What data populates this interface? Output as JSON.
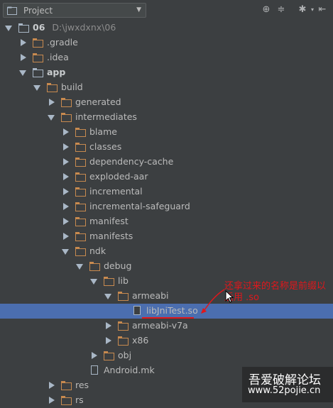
{
  "toolbar": {
    "project_label": "Project",
    "icons": [
      "target-icon",
      "collapse-all-icon",
      "gear-icon",
      "hide-icon"
    ]
  },
  "tree": [
    {
      "label": "06",
      "path": "D:\\jwxdxnx\\06",
      "state": "open",
      "kind": "module",
      "bold": true
    },
    {
      "label": ".gradle",
      "state": "closed",
      "kind": "folder"
    },
    {
      "label": ".idea",
      "state": "closed",
      "kind": "folder"
    },
    {
      "label": "app",
      "state": "open",
      "kind": "module",
      "bold": true
    },
    {
      "label": "build",
      "state": "open",
      "kind": "folder"
    },
    {
      "label": "generated",
      "state": "closed",
      "kind": "folder"
    },
    {
      "label": "intermediates",
      "state": "open",
      "kind": "folder"
    },
    {
      "label": "blame",
      "state": "closed",
      "kind": "folder"
    },
    {
      "label": "classes",
      "state": "closed",
      "kind": "folder"
    },
    {
      "label": "dependency-cache",
      "state": "closed",
      "kind": "folder"
    },
    {
      "label": "exploded-aar",
      "state": "closed",
      "kind": "folder"
    },
    {
      "label": "incremental",
      "state": "closed",
      "kind": "folder"
    },
    {
      "label": "incremental-safeguard",
      "state": "closed",
      "kind": "folder"
    },
    {
      "label": "manifest",
      "state": "closed",
      "kind": "folder"
    },
    {
      "label": "manifests",
      "state": "closed",
      "kind": "folder"
    },
    {
      "label": "ndk",
      "state": "open",
      "kind": "folder"
    },
    {
      "label": "debug",
      "state": "open",
      "kind": "folder"
    },
    {
      "label": "lib",
      "state": "open",
      "kind": "folder"
    },
    {
      "label": "armeabi",
      "state": "open",
      "kind": "folder"
    },
    {
      "label": "libJniTest.so",
      "state": "leaf",
      "kind": "file",
      "selected": true
    },
    {
      "label": "armeabi-v7a",
      "state": "closed",
      "kind": "folder"
    },
    {
      "label": "x86",
      "state": "closed",
      "kind": "folder"
    },
    {
      "label": "obj",
      "state": "closed",
      "kind": "folder"
    },
    {
      "label": "Android.mk",
      "state": "leaf",
      "kind": "file"
    },
    {
      "label": "res",
      "state": "closed",
      "kind": "folder"
    },
    {
      "label": "rs",
      "state": "closed",
      "kind": "folder"
    }
  ],
  "annotation": "还拿过来的名称是前缀以后用 .so",
  "watermark": {
    "line1": "吾爱破解论坛",
    "line2": "www.52pojie.cn"
  },
  "colors": {
    "background": "#3c3f41",
    "selection": "#4b6eaf",
    "folder": "#c88a4f",
    "annotation": "#e0171b"
  }
}
